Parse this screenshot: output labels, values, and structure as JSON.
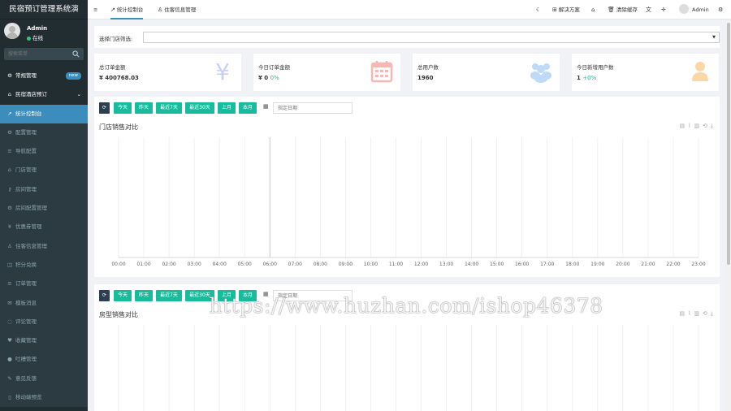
{
  "sidebar": {
    "brand": "民宿预订管理系统演",
    "user": {
      "name": "Admin",
      "status": "在线"
    },
    "search_placeholder": "搜索菜单",
    "groups": [
      {
        "label": "常规管理",
        "icon": "gear-icon",
        "badge": "new"
      },
      {
        "label": "民宿酒店预订",
        "icon": "home-icon"
      }
    ],
    "items": [
      {
        "label": "统计控制台",
        "icon": "chart-line-icon",
        "active": true
      },
      {
        "label": "配置管理",
        "icon": "gear-icon"
      },
      {
        "label": "导航配置",
        "icon": "list-icon"
      },
      {
        "label": "门店管理",
        "icon": "bank-icon"
      },
      {
        "label": "房间管理",
        "icon": "key-icon"
      },
      {
        "label": "房间配置管理",
        "icon": "gear-icon"
      },
      {
        "label": "优惠券管理",
        "icon": "yen-icon"
      },
      {
        "label": "住客信息管理",
        "icon": "user-icon"
      },
      {
        "label": "积分兑换",
        "icon": "gift-icon"
      },
      {
        "label": "订单管理",
        "icon": "list-icon"
      },
      {
        "label": "模板消息",
        "icon": "envelope-icon"
      },
      {
        "label": "评论管理",
        "icon": "comments-icon"
      },
      {
        "label": "收藏管理",
        "icon": "heart-icon"
      },
      {
        "label": "吐槽管理",
        "icon": "comment-icon"
      },
      {
        "label": "意见反馈",
        "icon": "pencil-icon"
      },
      {
        "label": "移动端预览",
        "icon": "mobile-icon"
      }
    ]
  },
  "topbar": {
    "tabs": [
      {
        "label": "统计控制台",
        "icon": "chart-line-icon",
        "active": true
      },
      {
        "label": "住客信息管理",
        "icon": "user-icon",
        "active": false
      }
    ],
    "actions": {
      "solutions": "解决方案",
      "clear_cache": "清除缓存",
      "username": "Admin"
    }
  },
  "filter": {
    "label": "选择门店筛选:"
  },
  "stats": [
    {
      "label": "总订单金额",
      "value": "¥ 400768.03",
      "extra": "",
      "icon": "yen-icon",
      "color": "#c9cff5"
    },
    {
      "label": "今日订单金额",
      "value": "¥ 0",
      "extra": "0%",
      "icon": "calendar-icon",
      "color": "#f6b8b3"
    },
    {
      "label": "总用户数",
      "value": "1960",
      "extra": "",
      "icon": "users-icon",
      "color": "#bfd9f8"
    },
    {
      "label": "今日新增用户数",
      "value": "1",
      "extra": "+0%",
      "icon": "user-icon",
      "color": "#fbd7a6"
    }
  ],
  "date_buttons": [
    "今天",
    "昨天",
    "最近7天",
    "最近30天",
    "上月",
    "本月"
  ],
  "date_placeholder": "指定日期",
  "charts": [
    {
      "title": "门店销售对比"
    },
    {
      "title": "房型销售对比"
    }
  ],
  "chart_data": {
    "type": "line",
    "title": "门店销售对比",
    "x": [
      "00:00",
      "01:00",
      "02:00",
      "03:00",
      "04:00",
      "05:00",
      "06:00",
      "07:00",
      "08:00",
      "09:00",
      "10:00",
      "11:00",
      "12:00",
      "13:00",
      "14:00",
      "15:00",
      "16:00",
      "17:00",
      "18:00",
      "19:00",
      "20:00",
      "21:00",
      "22:00",
      "23:00"
    ],
    "series": [],
    "grid": true
  },
  "watermark": "https://www.huzhan.com/ishop46378"
}
